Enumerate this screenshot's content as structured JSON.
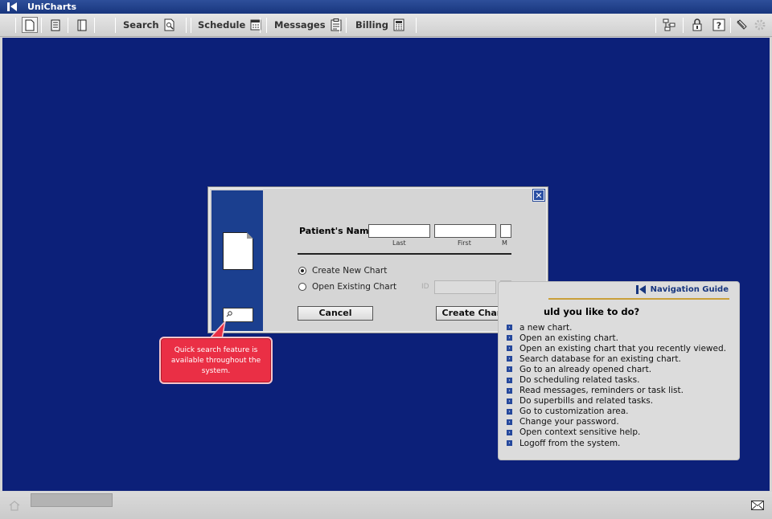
{
  "app": {
    "title": "UniCharts"
  },
  "toolbar": {
    "search_label": "Search",
    "schedule_label": "Schedule",
    "messages_label": "Messages",
    "billing_label": "Billing",
    "icons": [
      "new-chart-icon",
      "chart-list-icon",
      "chart-icon",
      "search-doc-icon",
      "calendar-icon",
      "clipboard-icon",
      "calculator-icon",
      "network-icon",
      "lock-icon",
      "help-icon",
      "logoff-icon",
      "settings-icon"
    ]
  },
  "dialog": {
    "patient_label": "Patient's Name",
    "last_sub": "Last",
    "first_sub": "First",
    "middle_sub": "M",
    "last_value": "",
    "first_value": "",
    "middle_value": "",
    "radio_new": "Create New Chart",
    "radio_new_selected": true,
    "radio_existing": "Open Existing Chart",
    "id_label": "ID",
    "id_value": "",
    "cancel_label": "Cancel",
    "create_label": "Create Chart",
    "close_label": "✕"
  },
  "callout": {
    "text": "Quick search feature is available throughout the system."
  },
  "navguide": {
    "title": "Navigation Guide",
    "question": "uld you like to do?",
    "items": [
      "a new chart.",
      "Open an existing chart.",
      "Open an existing chart that you recently viewed.",
      "Search database for an existing chart.",
      "Go to an already opened chart.",
      "Do scheduling related tasks.",
      "Read messages, reminders or task list.",
      "Do superbills and related tasks.",
      "Go to customization area.",
      "Change your password.",
      "Open context sensitive help.",
      "Logoff from the system."
    ]
  },
  "colors": {
    "workspace": "#0c2079",
    "accent": "#1b3f8f",
    "callout": "#ea2f45",
    "guide_rule": "#c99f3a"
  }
}
